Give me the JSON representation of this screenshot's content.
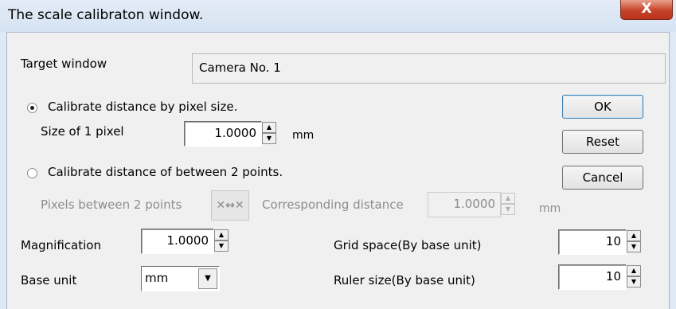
{
  "window": {
    "title": "The scale calibraton window.",
    "close_label": "X"
  },
  "target": {
    "label": "Target window",
    "value": "Camera No. 1"
  },
  "pixel_mode": {
    "label": "Calibrate distance by pixel size.",
    "selected": true,
    "size_label": "Size of 1 pixel",
    "size_value": "1.0000",
    "unit": "mm"
  },
  "points_mode": {
    "label": "Calibrate distance of between 2 points.",
    "selected": false,
    "pixels_label": "Pixels between 2 points",
    "measure_icon": "✕↔✕",
    "distance_label": "Corresponding distance",
    "distance_value": "1.0000",
    "unit": "mm"
  },
  "magnification": {
    "label": "Magnification",
    "value": "1.0000"
  },
  "base_unit": {
    "label": "Base unit",
    "value": "mm"
  },
  "grid_space": {
    "label": "Grid space(By base unit)",
    "value": "10"
  },
  "ruler_size": {
    "label": "Ruler size(By base unit)",
    "value": "10"
  },
  "buttons": {
    "ok": "OK",
    "reset": "Reset",
    "cancel": "Cancel"
  },
  "spin_glyphs": {
    "up": "▲",
    "down": "▼"
  }
}
